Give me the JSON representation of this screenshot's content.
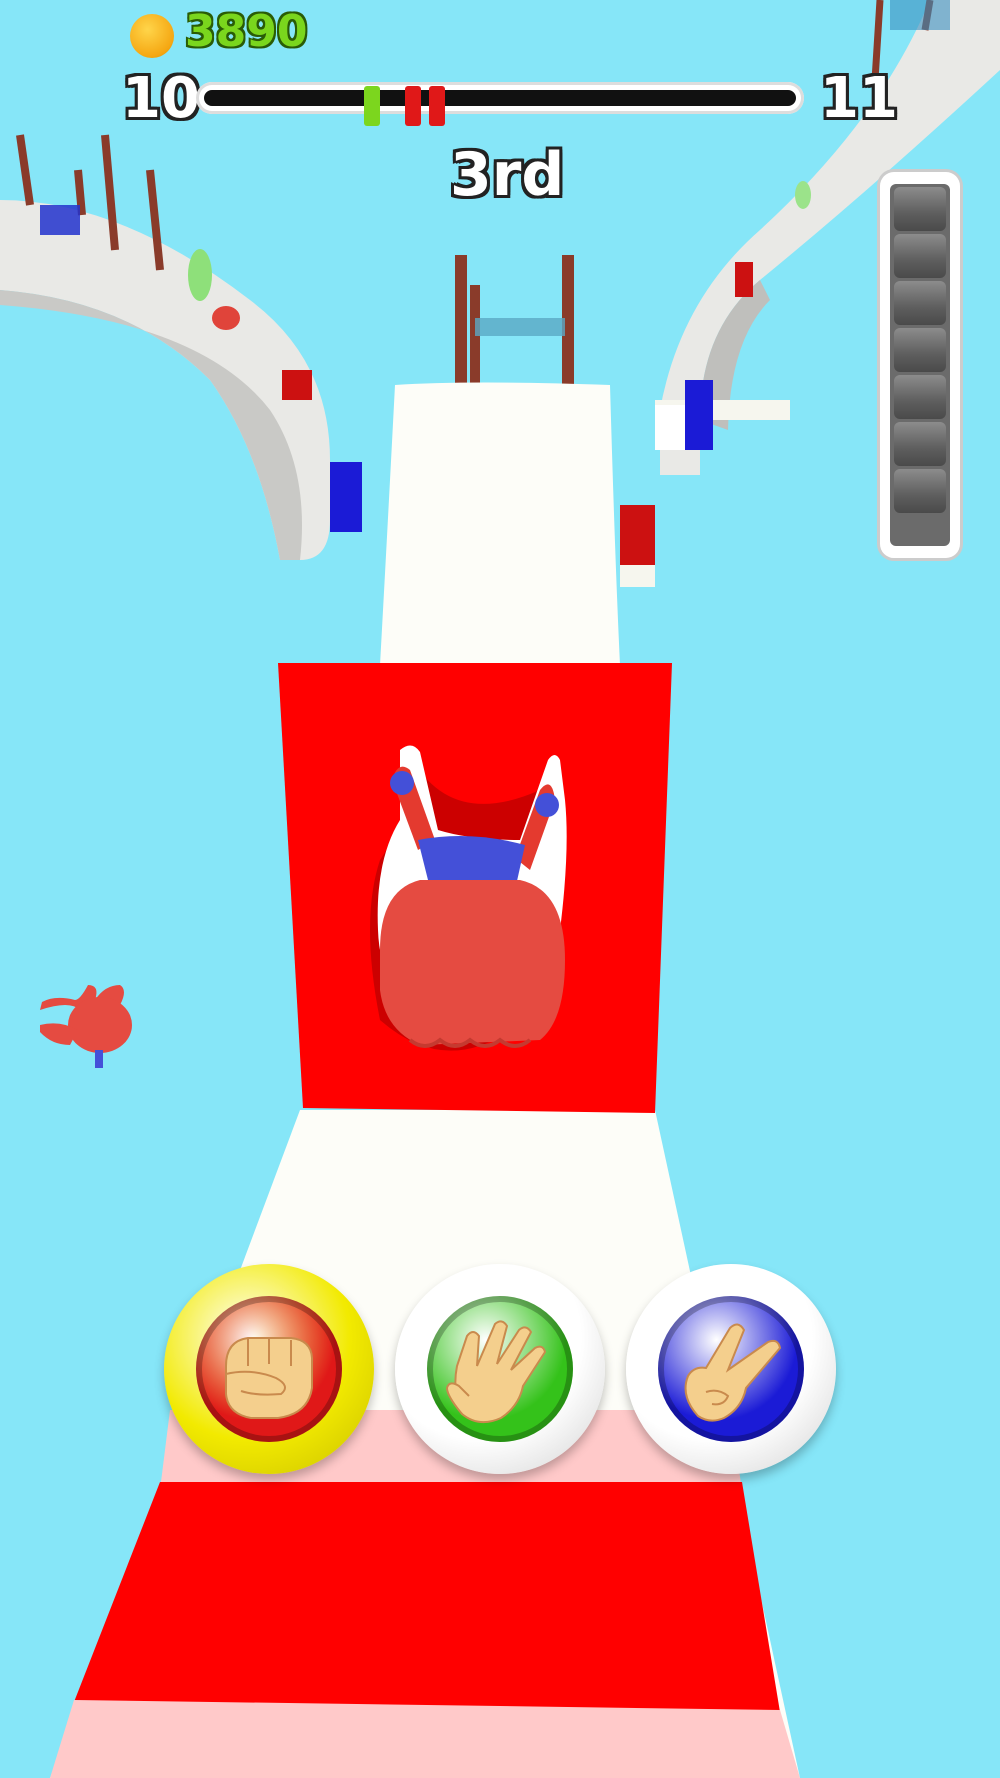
{
  "hud": {
    "coins": "3890",
    "level_current": "10",
    "level_next": "11",
    "rank": "3rd",
    "progress": {
      "player_fraction": 0.27,
      "opponent_fractions": [
        0.34,
        0.38
      ],
      "player_color": "#7cd61e",
      "opponent_color": "#e01818"
    },
    "power_meter_segments": 7,
    "power_meter_filled": 0
  },
  "choices": [
    {
      "name": "rock",
      "icon": "fist-icon",
      "ring_color": "#f2ea00",
      "core_color": "#e01818",
      "selected": true
    },
    {
      "name": "paper",
      "icon": "open-hand-icon",
      "ring_color": "#ffffff",
      "core_color": "#34c21a",
      "selected": false
    },
    {
      "name": "scissors",
      "icon": "peace-sign-icon",
      "ring_color": "#ffffff",
      "core_color": "#1b1bd6",
      "selected": false
    }
  ],
  "colors": {
    "sky": "#86e6f8",
    "track_red": "#ff0000",
    "track_white": "#fdfdf8",
    "track_pink": "#ffc9c9"
  }
}
